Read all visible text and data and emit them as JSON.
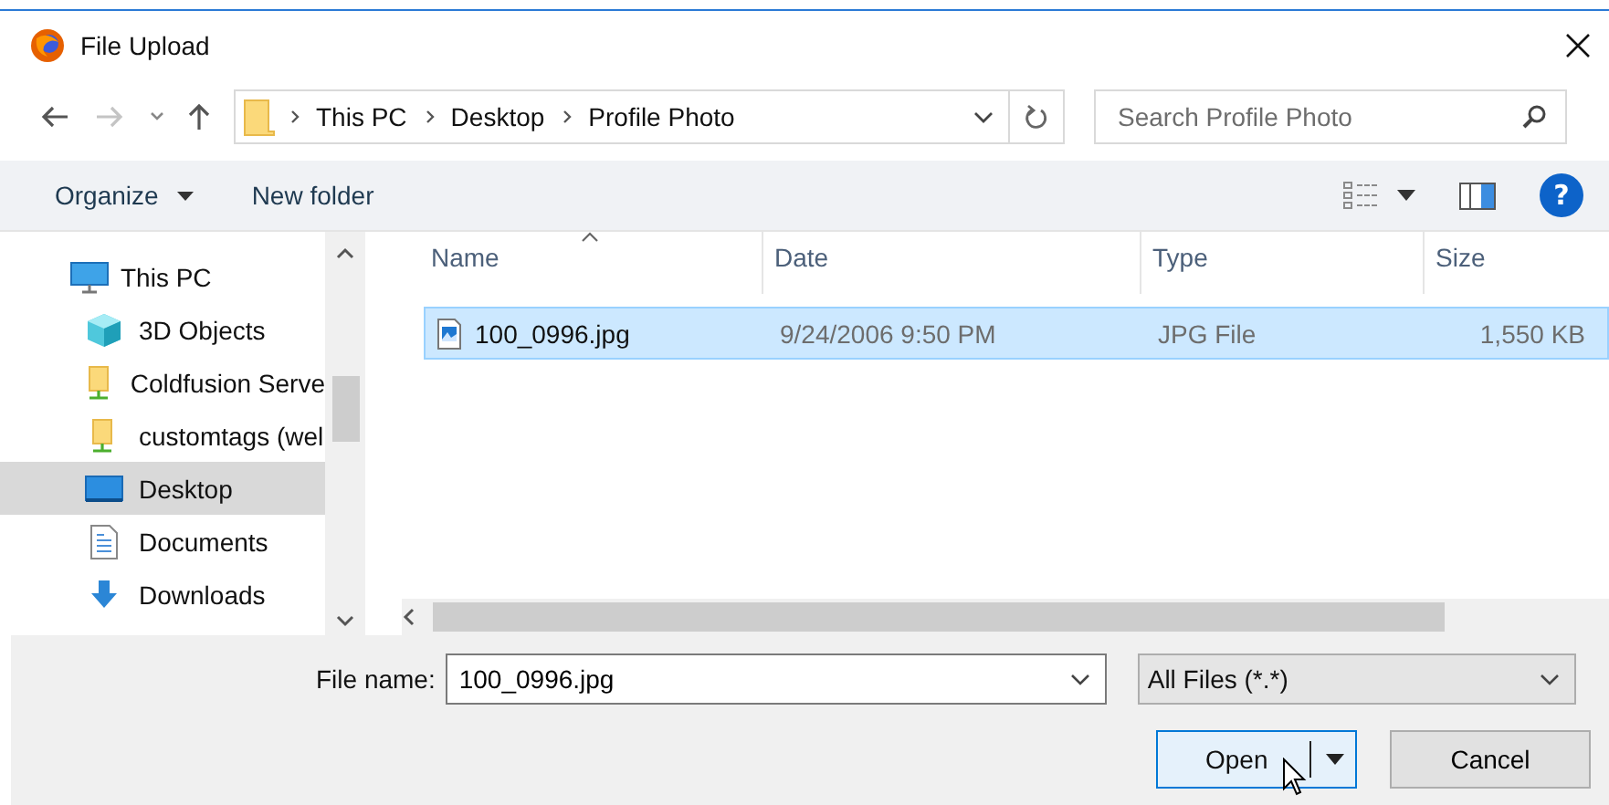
{
  "window": {
    "title": "File Upload"
  },
  "breadcrumb": [
    "This PC",
    "Desktop",
    "Profile Photo"
  ],
  "search": {
    "placeholder": "Search Profile Photo"
  },
  "toolbar": {
    "organize": "Organize",
    "new_folder": "New folder",
    "help": "?"
  },
  "sidebar": {
    "items": [
      {
        "label": "This PC",
        "kind": "pc",
        "selected": false,
        "children": [
          {
            "label": "3D Objects",
            "kind": "objects",
            "selected": false
          },
          {
            "label": "Coldfusion Serve",
            "kind": "network-folder",
            "selected": false
          },
          {
            "label": "customtags (wel",
            "kind": "network-folder",
            "selected": false
          },
          {
            "label": "Desktop",
            "kind": "desktop",
            "selected": true
          },
          {
            "label": "Documents",
            "kind": "documents",
            "selected": false
          },
          {
            "label": "Downloads",
            "kind": "downloads",
            "selected": false
          }
        ]
      }
    ]
  },
  "table": {
    "columns": [
      "Name",
      "Date",
      "Type",
      "Size"
    ],
    "rows": [
      {
        "name": "100_0996.jpg",
        "date": "9/24/2006 9:50 PM",
        "type": "JPG File",
        "size": "1,550 KB",
        "selected": true
      }
    ]
  },
  "file_name": {
    "label": "File name:",
    "value": "100_0996.jpg"
  },
  "file_type": {
    "value": "All Files (*.*)"
  },
  "buttons": {
    "open": "Open",
    "cancel": "Cancel"
  }
}
